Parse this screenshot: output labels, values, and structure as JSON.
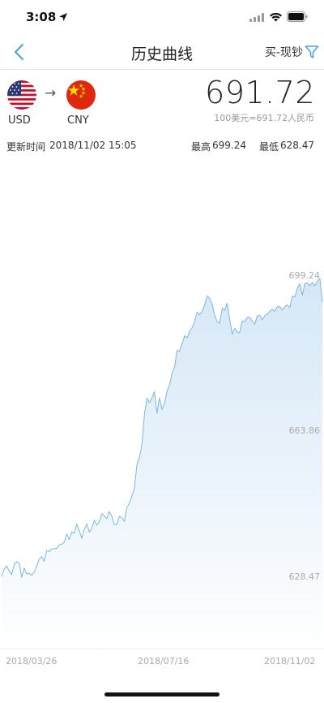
{
  "status_bar": {
    "time": "3:08",
    "icons": [
      "location-arrow-icon",
      "signal-icon",
      "wifi-icon",
      "battery-icon"
    ]
  },
  "nav": {
    "title": "历史曲线",
    "filter_label": "买-现钞",
    "back_icon": "chevron-left-icon",
    "filter_icon": "filter-icon",
    "accent_color": "#4a9fd8"
  },
  "currency": {
    "from_code": "USD",
    "to_code": "CNY",
    "from_flag": "us-flag-icon",
    "to_flag": "cn-flag-icon",
    "rate": "691.72",
    "rate_note": "100美元=691.72人民币"
  },
  "info": {
    "update_label": "更新时间",
    "update_time": "2018/11/02 15:05",
    "high_label": "最高",
    "high_value": "699.24",
    "low_label": "最低",
    "low_value": "628.47"
  },
  "chart_data": {
    "type": "area",
    "y_ticks": [
      "699.24",
      "663.86",
      "628.47"
    ],
    "x_ticks": [
      "2018/03/26",
      "2018/07/16",
      "2018/11/02"
    ],
    "ylim": [
      628.47,
      699.24
    ],
    "line_color": "#7cb6e0",
    "fill_color": "#dbeaf7",
    "series": [
      {
        "values": [
          629.0,
          630.7,
          631.5,
          630.3,
          629.5,
          631.8,
          632.5,
          632.2,
          628.8,
          631.0,
          629.6,
          629.8,
          629.3,
          630.0,
          631.5,
          633.1,
          633.7,
          632.6,
          635.1,
          634.9,
          635.5,
          635.6,
          635.6,
          636.5,
          636.6,
          637.1,
          639.0,
          637.7,
          639.5,
          639.2,
          641.4,
          639.8,
          638.0,
          640.1,
          641.4,
          639.5,
          640.4,
          642.3,
          641.1,
          642.0,
          643.8,
          643.2,
          642.7,
          644.3,
          643.2,
          641.2,
          641.3,
          643.2,
          642.9,
          642.0,
          645.4,
          646.2,
          648.0,
          649.9,
          655.4,
          657.1,
          660.2,
          667.3,
          671.0,
          670.0,
          671.1,
          672.6,
          667.5,
          671.1,
          668.4,
          669.8,
          672.7,
          674.1,
          676.9,
          678.4,
          682.3,
          682.1,
          683.8,
          685.7,
          685.2,
          686.8,
          687.6,
          689.1,
          691.3,
          690.7,
          691.5,
          693.0,
          695.1,
          694.6,
          693.2,
          690.6,
          689.1,
          688.7,
          692.2,
          691.7,
          693.4,
          689.8,
          686.1,
          687.5,
          686.6,
          686.5,
          689.2,
          689.1,
          690.0,
          690.1,
          689.2,
          688.4,
          690.4,
          690.6,
          689.5,
          690.5,
          690.8,
          691.5,
          692.0,
          691.5,
          692.6,
          692.6,
          691.8,
          692.6,
          693.0,
          692.4,
          695.1,
          694.9,
          697.0,
          698.0,
          695.3,
          698.0,
          698.2,
          697.5,
          698.3,
          697.5,
          698.6,
          699.2,
          693.7
        ]
      }
    ]
  }
}
